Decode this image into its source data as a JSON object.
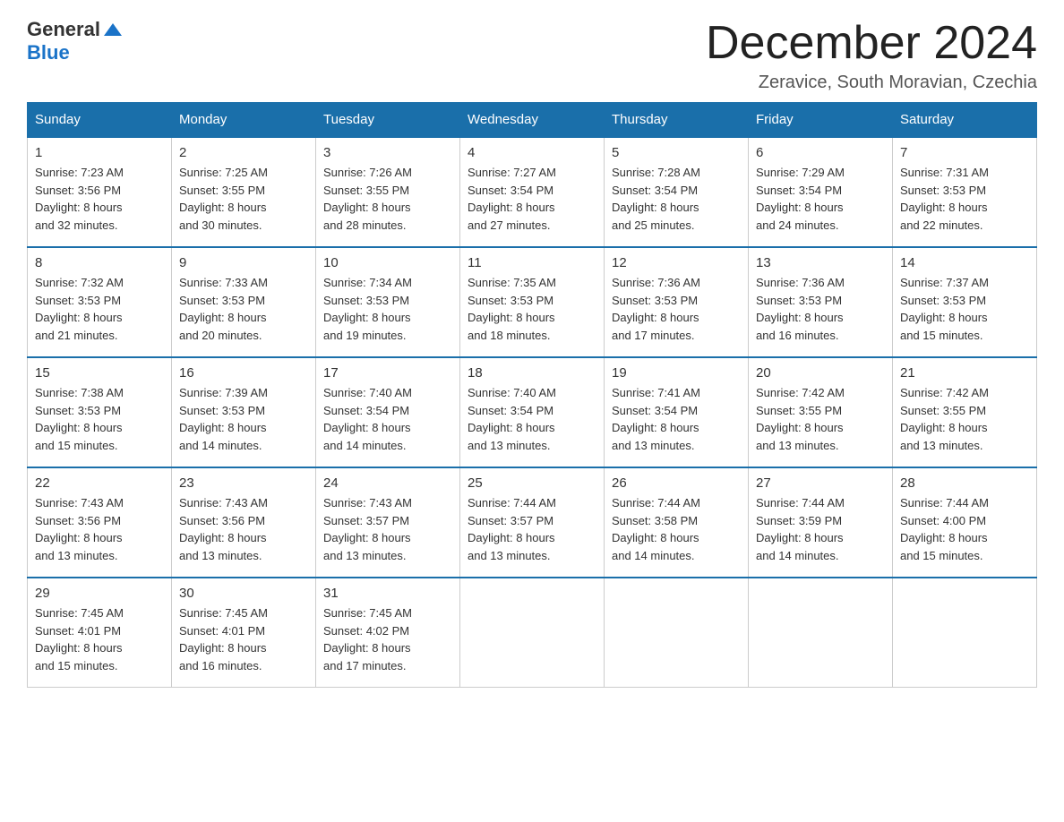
{
  "logo": {
    "general": "General",
    "blue": "Blue"
  },
  "title": "December 2024",
  "location": "Zeravice, South Moravian, Czechia",
  "days_of_week": [
    "Sunday",
    "Monday",
    "Tuesday",
    "Wednesday",
    "Thursday",
    "Friday",
    "Saturday"
  ],
  "weeks": [
    [
      {
        "day": "1",
        "sunrise": "7:23 AM",
        "sunset": "3:56 PM",
        "daylight": "8 hours and 32 minutes."
      },
      {
        "day": "2",
        "sunrise": "7:25 AM",
        "sunset": "3:55 PM",
        "daylight": "8 hours and 30 minutes."
      },
      {
        "day": "3",
        "sunrise": "7:26 AM",
        "sunset": "3:55 PM",
        "daylight": "8 hours and 28 minutes."
      },
      {
        "day": "4",
        "sunrise": "7:27 AM",
        "sunset": "3:54 PM",
        "daylight": "8 hours and 27 minutes."
      },
      {
        "day": "5",
        "sunrise": "7:28 AM",
        "sunset": "3:54 PM",
        "daylight": "8 hours and 25 minutes."
      },
      {
        "day": "6",
        "sunrise": "7:29 AM",
        "sunset": "3:54 PM",
        "daylight": "8 hours and 24 minutes."
      },
      {
        "day": "7",
        "sunrise": "7:31 AM",
        "sunset": "3:53 PM",
        "daylight": "8 hours and 22 minutes."
      }
    ],
    [
      {
        "day": "8",
        "sunrise": "7:32 AM",
        "sunset": "3:53 PM",
        "daylight": "8 hours and 21 minutes."
      },
      {
        "day": "9",
        "sunrise": "7:33 AM",
        "sunset": "3:53 PM",
        "daylight": "8 hours and 20 minutes."
      },
      {
        "day": "10",
        "sunrise": "7:34 AM",
        "sunset": "3:53 PM",
        "daylight": "8 hours and 19 minutes."
      },
      {
        "day": "11",
        "sunrise": "7:35 AM",
        "sunset": "3:53 PM",
        "daylight": "8 hours and 18 minutes."
      },
      {
        "day": "12",
        "sunrise": "7:36 AM",
        "sunset": "3:53 PM",
        "daylight": "8 hours and 17 minutes."
      },
      {
        "day": "13",
        "sunrise": "7:36 AM",
        "sunset": "3:53 PM",
        "daylight": "8 hours and 16 minutes."
      },
      {
        "day": "14",
        "sunrise": "7:37 AM",
        "sunset": "3:53 PM",
        "daylight": "8 hours and 15 minutes."
      }
    ],
    [
      {
        "day": "15",
        "sunrise": "7:38 AM",
        "sunset": "3:53 PM",
        "daylight": "8 hours and 15 minutes."
      },
      {
        "day": "16",
        "sunrise": "7:39 AM",
        "sunset": "3:53 PM",
        "daylight": "8 hours and 14 minutes."
      },
      {
        "day": "17",
        "sunrise": "7:40 AM",
        "sunset": "3:54 PM",
        "daylight": "8 hours and 14 minutes."
      },
      {
        "day": "18",
        "sunrise": "7:40 AM",
        "sunset": "3:54 PM",
        "daylight": "8 hours and 13 minutes."
      },
      {
        "day": "19",
        "sunrise": "7:41 AM",
        "sunset": "3:54 PM",
        "daylight": "8 hours and 13 minutes."
      },
      {
        "day": "20",
        "sunrise": "7:42 AM",
        "sunset": "3:55 PM",
        "daylight": "8 hours and 13 minutes."
      },
      {
        "day": "21",
        "sunrise": "7:42 AM",
        "sunset": "3:55 PM",
        "daylight": "8 hours and 13 minutes."
      }
    ],
    [
      {
        "day": "22",
        "sunrise": "7:43 AM",
        "sunset": "3:56 PM",
        "daylight": "8 hours and 13 minutes."
      },
      {
        "day": "23",
        "sunrise": "7:43 AM",
        "sunset": "3:56 PM",
        "daylight": "8 hours and 13 minutes."
      },
      {
        "day": "24",
        "sunrise": "7:43 AM",
        "sunset": "3:57 PM",
        "daylight": "8 hours and 13 minutes."
      },
      {
        "day": "25",
        "sunrise": "7:44 AM",
        "sunset": "3:57 PM",
        "daylight": "8 hours and 13 minutes."
      },
      {
        "day": "26",
        "sunrise": "7:44 AM",
        "sunset": "3:58 PM",
        "daylight": "8 hours and 14 minutes."
      },
      {
        "day": "27",
        "sunrise": "7:44 AM",
        "sunset": "3:59 PM",
        "daylight": "8 hours and 14 minutes."
      },
      {
        "day": "28",
        "sunrise": "7:44 AM",
        "sunset": "4:00 PM",
        "daylight": "8 hours and 15 minutes."
      }
    ],
    [
      {
        "day": "29",
        "sunrise": "7:45 AM",
        "sunset": "4:01 PM",
        "daylight": "8 hours and 15 minutes."
      },
      {
        "day": "30",
        "sunrise": "7:45 AM",
        "sunset": "4:01 PM",
        "daylight": "8 hours and 16 minutes."
      },
      {
        "day": "31",
        "sunrise": "7:45 AM",
        "sunset": "4:02 PM",
        "daylight": "8 hours and 17 minutes."
      },
      null,
      null,
      null,
      null
    ]
  ],
  "labels": {
    "sunrise": "Sunrise:",
    "sunset": "Sunset:",
    "daylight": "Daylight:"
  }
}
